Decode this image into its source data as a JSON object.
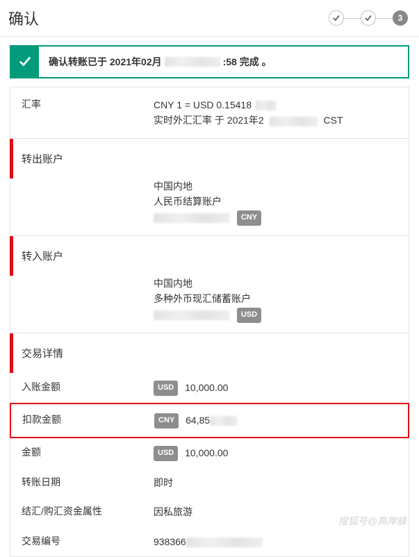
{
  "header": {
    "title": "确认"
  },
  "steps": {
    "s1": "done",
    "s2": "done",
    "s3": "3"
  },
  "success": {
    "prefix": "确认转账已于 2021年02月",
    "suffix": ":58 完成 。"
  },
  "rate": {
    "label": "汇率",
    "line1": "CNY 1 = USD 0.15418",
    "line2_prefix": "实时外汇汇率 于 2021年2",
    "line2_suffix": "CST"
  },
  "out_account": {
    "title": "转出账户",
    "region": "中国内地",
    "account_type": "人民币结算账户",
    "currency": "CNY"
  },
  "in_account": {
    "title": "转入账户",
    "region": "中国内地",
    "account_type": "多种外币现汇储蓄账户",
    "currency": "USD"
  },
  "details": {
    "title": "交易详情",
    "credit_label": "入账金额",
    "credit_curr": "USD",
    "credit_amount": "10,000.00",
    "debit_label": "扣款金额",
    "debit_curr": "CNY",
    "debit_amount": "64,85",
    "amount_label": "金额",
    "amount_curr": "USD",
    "amount_value": "10,000.00",
    "date_label": "转账日期",
    "date_value": "即时",
    "purpose_label": "结汇/购汇资金属性",
    "purpose_value": "因私旅游",
    "ref_label": "交易编号",
    "ref_value": "938366"
  },
  "watermark": "搜狐号@高岸蜂"
}
